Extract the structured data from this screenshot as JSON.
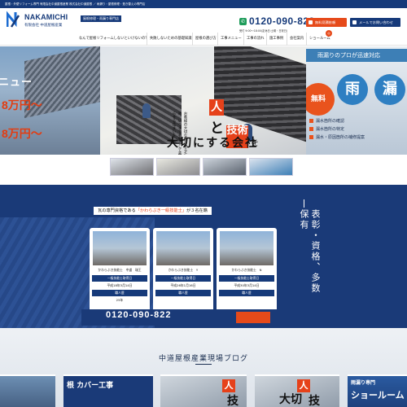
{
  "top_strip": {
    "text": "屋根・外壁リフォーム専門 有限会社中道屋根産業 株式会社中道屋根 ／ 雨漏り・屋根修理・葺き替えの専門店"
  },
  "header": {
    "logo_text": "NAKAMICHI",
    "logo_sub": "有限会社 中道屋根産業",
    "tagline": "屋根修理・雨漏り専門店",
    "phone": "0120-090-822",
    "hours": "受付 9:00〜18:00(定休日:土曜・日祝日)",
    "btn_estimate": "無料見積依頼",
    "btn_mail": "メールでお問い合わせ"
  },
  "nav": {
    "items": [
      "なんで屋根リフォームしないといけないの？",
      "失敗しないための基礎知識",
      "屋根の選び方",
      "工事メニュー",
      "工事の流れ",
      "施工事例",
      "会社案内",
      "ショールーム"
    ]
  },
  "hero": {
    "left_title": "ニュー",
    "left_price1": "8万円〜",
    "left_price2": "8万円〜",
    "main_char1": "人",
    "main_char2": "と",
    "main_char3": "技術",
    "main_char4": "を",
    "main_char5": "大切にする会社",
    "main_sub": "お客様の大切な家を守るため、いつまでも安心して暮らせる住まいを",
    "right_top": "雨漏りのプロが迅速対応",
    "right_free": "無料",
    "right_ame": "雨",
    "right_mori": "漏",
    "right_list": [
      "漏水箇所の確認",
      "漏水箇所の特定",
      "漏水・原因箇所の補修提案"
    ]
  },
  "qualifications": {
    "title_pre": "瓦の専門資格である",
    "title_hl": "「かわらぶき一級技能士」",
    "title_post": "が３名在籍",
    "vertical": "表彰・資格、多数保有",
    "cards": [
      {
        "sign": "かわらぶき技能士　中道　瑞王",
        "r1": "一級技能士取得日",
        "r2": "平成18年3月14日",
        "r3": "職人歴",
        "r4": "25年"
      },
      {
        "sign": "かわらぶき技能士　Y",
        "r1": "一級技能士取得日",
        "r2": "平成26年1月16日",
        "r3": "職人歴",
        "r4": ""
      },
      {
        "sign": "かわらぶき技能士　N",
        "r1": "一級技能士取得日",
        "r2": "平成30年3月14日",
        "r3": "職人歴",
        "r4": ""
      }
    ],
    "phone": "0120-090-822"
  },
  "blog": {
    "title": "中道屋根産業現場ブログ",
    "card_texts": [
      "根 カバー工事",
      "人",
      "技",
      "人",
      "大切",
      "技",
      "雨漏り専門",
      "ショールーム"
    ]
  }
}
